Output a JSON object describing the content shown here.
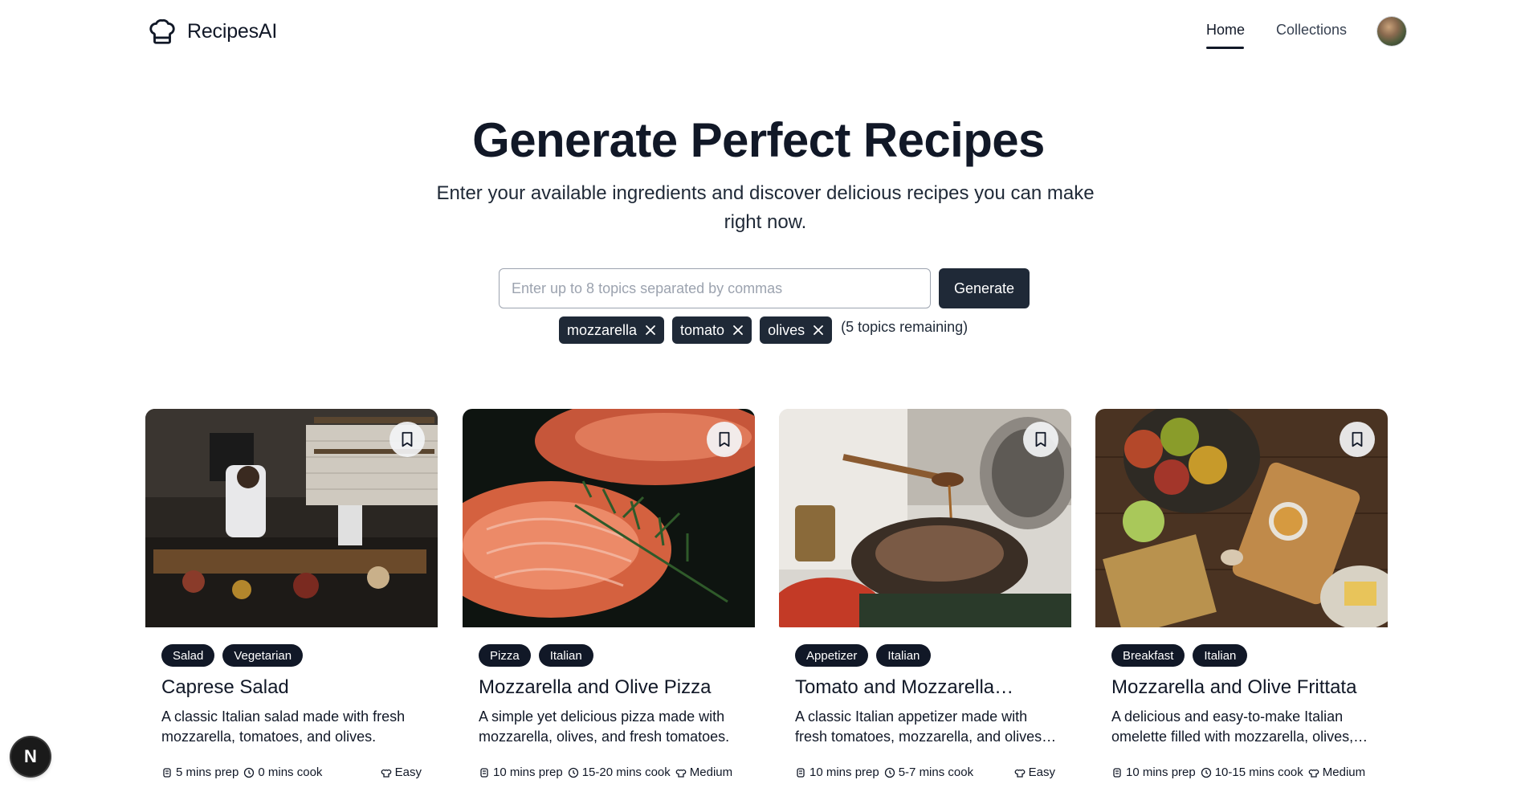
{
  "app": {
    "name": "RecipesAI"
  },
  "nav": {
    "home": "Home",
    "collections": "Collections"
  },
  "hero": {
    "title": "Generate Perfect Recipes",
    "subtitle": "Enter your available ingredients and discover delicious recipes you can make right now."
  },
  "search": {
    "placeholder": "Enter up to 8 topics separated by commas",
    "value": "",
    "button": "Generate"
  },
  "topics": {
    "chips": [
      "mozzarella",
      "tomato",
      "olives"
    ],
    "remaining": "(5 topics remaining)"
  },
  "cards": [
    {
      "tags": [
        "Salad",
        "Vegetarian"
      ],
      "title": "Caprese Salad",
      "description": "A classic Italian salad made with fresh mozzarella, tomatoes, and olives.",
      "prep": "5 mins prep",
      "cook": "0 mins cook",
      "difficulty": "Easy",
      "image": "kitchen-chef-photo"
    },
    {
      "tags": [
        "Pizza",
        "Italian"
      ],
      "title": "Mozzarella and Olive Pizza",
      "description": "A simple yet delicious pizza made with mozzarella, olives, and fresh tomatoes.",
      "prep": "10 mins prep",
      "cook": "15-20 mins cook",
      "difficulty": "Medium",
      "image": "salmon-rosemary-photo"
    },
    {
      "tags": [
        "Appetizer",
        "Italian"
      ],
      "title": "Tomato and Mozzarella…",
      "description": "A classic Italian appetizer made with fresh tomatoes, mozzarella, and olives…",
      "prep": "10 mins prep",
      "cook": "5-7 mins cook",
      "difficulty": "Easy",
      "image": "cooking-pour-photo"
    },
    {
      "tags": [
        "Breakfast",
        "Italian"
      ],
      "title": "Mozzarella and Olive Frittata",
      "description": "A delicious and easy-to-make Italian omelette filled with mozzarella, olives,…",
      "prep": "10 mins prep",
      "cook": "10-15 mins cook",
      "difficulty": "Medium",
      "image": "apples-board-photo"
    }
  ],
  "dev_badge": "N",
  "colors": {
    "primary": "#1f2937",
    "text": "#111827",
    "border": "#9ca3af"
  }
}
